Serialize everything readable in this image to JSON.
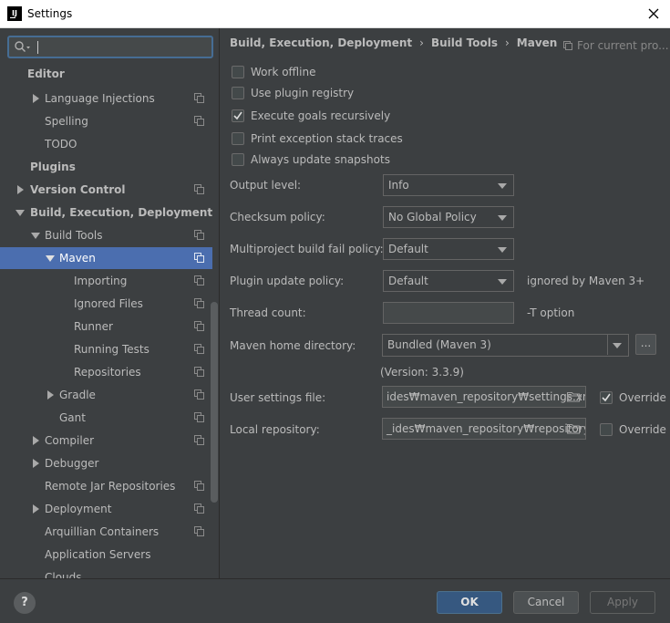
{
  "window": {
    "title": "Settings",
    "app_icon_text": "IJ"
  },
  "search": {
    "value": "",
    "placeholder": ""
  },
  "tree": [
    {
      "label": "Editor",
      "bold": true,
      "indent": 0,
      "arrow": "none",
      "icon": false
    },
    {
      "label": "Language Injections",
      "bold": false,
      "indent": 2,
      "arrow": "right",
      "icon": true
    },
    {
      "label": "Spelling",
      "bold": false,
      "indent": 2,
      "arrow": "none",
      "icon": true
    },
    {
      "label": "TODO",
      "bold": false,
      "indent": 2,
      "arrow": "none",
      "icon": false
    },
    {
      "label": "Plugins",
      "bold": true,
      "indent": 1,
      "arrow": "none",
      "icon": false
    },
    {
      "label": "Version Control",
      "bold": true,
      "indent": 1,
      "arrow": "right",
      "icon": true
    },
    {
      "label": "Build, Execution, Deployment",
      "bold": true,
      "indent": 1,
      "arrow": "down",
      "icon": false
    },
    {
      "label": "Build Tools",
      "bold": false,
      "indent": 2,
      "arrow": "down",
      "icon": true
    },
    {
      "label": "Maven",
      "bold": false,
      "indent": 3,
      "arrow": "down",
      "icon": true,
      "selected": true
    },
    {
      "label": "Importing",
      "bold": false,
      "indent": 4,
      "arrow": "none",
      "icon": true
    },
    {
      "label": "Ignored Files",
      "bold": false,
      "indent": 4,
      "arrow": "none",
      "icon": true
    },
    {
      "label": "Runner",
      "bold": false,
      "indent": 4,
      "arrow": "none",
      "icon": true
    },
    {
      "label": "Running Tests",
      "bold": false,
      "indent": 4,
      "arrow": "none",
      "icon": true
    },
    {
      "label": "Repositories",
      "bold": false,
      "indent": 4,
      "arrow": "none",
      "icon": true
    },
    {
      "label": "Gradle",
      "bold": false,
      "indent": 3,
      "arrow": "right",
      "icon": true
    },
    {
      "label": "Gant",
      "bold": false,
      "indent": 3,
      "arrow": "none",
      "icon": true
    },
    {
      "label": "Compiler",
      "bold": false,
      "indent": 2,
      "arrow": "right",
      "icon": true
    },
    {
      "label": "Debugger",
      "bold": false,
      "indent": 2,
      "arrow": "right",
      "icon": false
    },
    {
      "label": "Remote Jar Repositories",
      "bold": false,
      "indent": 2,
      "arrow": "none",
      "icon": true
    },
    {
      "label": "Deployment",
      "bold": false,
      "indent": 2,
      "arrow": "right",
      "icon": true
    },
    {
      "label": "Arquillian Containers",
      "bold": false,
      "indent": 2,
      "arrow": "none",
      "icon": true
    },
    {
      "label": "Application Servers",
      "bold": false,
      "indent": 2,
      "arrow": "none",
      "icon": false
    },
    {
      "label": "Clouds",
      "bold": false,
      "indent": 2,
      "arrow": "none",
      "icon": false
    }
  ],
  "breadcrumb": {
    "part1": "Build, Execution, Deployment",
    "part2": "Build Tools",
    "part3": "Maven",
    "separator": "›",
    "for_current": "For current pro..."
  },
  "checkboxes": [
    {
      "label": "Work offline",
      "checked": false
    },
    {
      "label": "Use plugin registry",
      "checked": false
    },
    {
      "label": "Execute goals recursively",
      "checked": true
    },
    {
      "label": "Print exception stack traces",
      "checked": false
    },
    {
      "label": "Always update snapshots",
      "checked": false
    }
  ],
  "fields": {
    "output_level": {
      "label": "Output level:",
      "value": "Info"
    },
    "checksum_policy": {
      "label": "Checksum policy:",
      "value": "No Global Policy"
    },
    "fail_policy": {
      "label": "Multiproject build fail policy:",
      "value": "Default"
    },
    "plugin_update": {
      "label": "Plugin update policy:",
      "value": "Default",
      "hint": "ignored by Maven 3+"
    },
    "thread_count": {
      "label": "Thread count:",
      "value": "",
      "hint": "-T option"
    },
    "maven_home": {
      "label": "Maven home directory:",
      "value": "Bundled (Maven 3)",
      "dots": "...",
      "version": "(Version: 3.3.9)"
    },
    "user_settings": {
      "label": "User settings file:",
      "value": "ides₩maven_repository₩settings.xml",
      "override_label": "Override",
      "override_checked": true
    },
    "local_repo": {
      "label": "Local repository:",
      "value": "_ides₩maven_repository₩repository",
      "override_label": "Override",
      "override_checked": false
    }
  },
  "buttons": {
    "help": "?",
    "ok": "OK",
    "cancel": "Cancel",
    "apply": "Apply"
  }
}
